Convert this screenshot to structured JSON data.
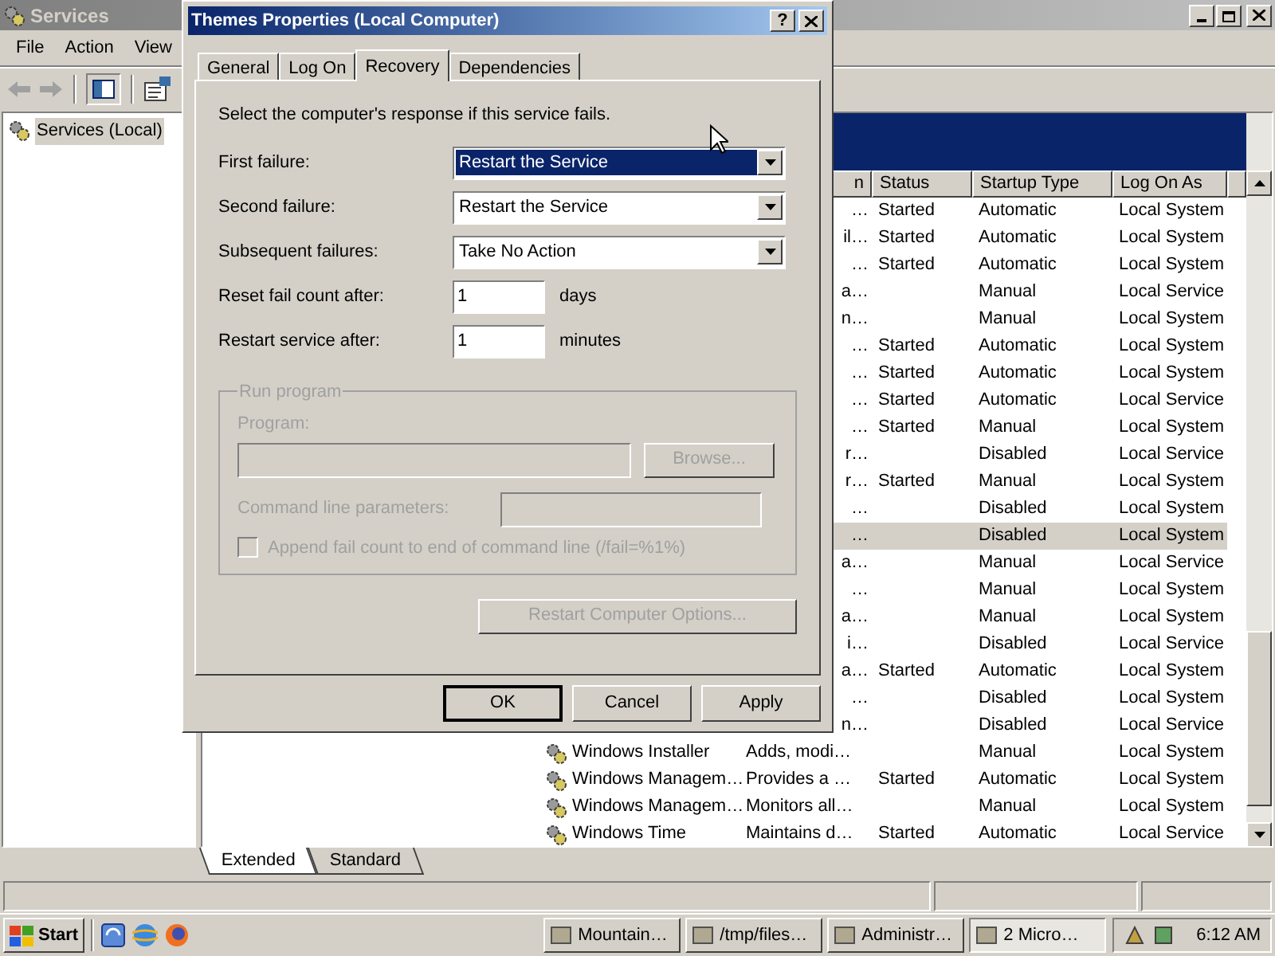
{
  "main_window": {
    "title": "Services",
    "menu": [
      "File",
      "Action",
      "View"
    ],
    "tree": [
      {
        "label": "Services (Local)",
        "selected": true
      }
    ],
    "list": {
      "columns": [
        "n",
        "Status",
        "Startup Type",
        "Log On As"
      ],
      "rows": [
        {
          "description": "…",
          "status": "Started",
          "startup": "Automatic",
          "logon": "Local System",
          "selected": false
        },
        {
          "description": "il…",
          "status": "Started",
          "startup": "Automatic",
          "logon": "Local System",
          "selected": false
        },
        {
          "description": "…",
          "status": "Started",
          "startup": "Automatic",
          "logon": "Local System",
          "selected": false
        },
        {
          "description": "a…",
          "status": "",
          "startup": "Manual",
          "logon": "Local Service",
          "selected": false
        },
        {
          "description": "n…",
          "status": "",
          "startup": "Manual",
          "logon": "Local System",
          "selected": false
        },
        {
          "description": "…",
          "status": "Started",
          "startup": "Automatic",
          "logon": "Local System",
          "selected": false
        },
        {
          "description": "…",
          "status": "Started",
          "startup": "Automatic",
          "logon": "Local System",
          "selected": false
        },
        {
          "description": "…",
          "status": "Started",
          "startup": "Automatic",
          "logon": "Local Service",
          "selected": false
        },
        {
          "description": "…",
          "status": "Started",
          "startup": "Manual",
          "logon": "Local System",
          "selected": false
        },
        {
          "description": "r…",
          "status": "",
          "startup": "Disabled",
          "logon": "Local Service",
          "selected": false
        },
        {
          "description": "r…",
          "status": "Started",
          "startup": "Manual",
          "logon": "Local System",
          "selected": false
        },
        {
          "description": "…",
          "status": "",
          "startup": "Disabled",
          "logon": "Local System",
          "selected": false
        },
        {
          "description": "…",
          "status": "",
          "startup": "Disabled",
          "logon": "Local System",
          "selected": true
        },
        {
          "description": "a…",
          "status": "",
          "startup": "Manual",
          "logon": "Local Service",
          "selected": false
        },
        {
          "description": "…",
          "status": "",
          "startup": "Manual",
          "logon": "Local System",
          "selected": false
        },
        {
          "description": "a…",
          "status": "",
          "startup": "Manual",
          "logon": "Local System",
          "selected": false
        },
        {
          "description": "i…",
          "status": "",
          "startup": "Disabled",
          "logon": "Local Service",
          "selected": false
        },
        {
          "description": "a…",
          "status": "Started",
          "startup": "Automatic",
          "logon": "Local System",
          "selected": false
        },
        {
          "description": "…",
          "status": "",
          "startup": "Disabled",
          "logon": "Local System",
          "selected": false
        },
        {
          "description": "n…",
          "status": "",
          "startup": "Disabled",
          "logon": "Local Service",
          "selected": false
        },
        {
          "name": "Windows Installer",
          "description": "Adds, modi…",
          "status": "",
          "startup": "Manual",
          "logon": "Local System",
          "selected": false
        },
        {
          "name": "Windows Managem…",
          "description": "Provides a …",
          "status": "Started",
          "startup": "Automatic",
          "logon": "Local System",
          "selected": false
        },
        {
          "name": "Windows Managem…",
          "description": "Monitors all…",
          "status": "",
          "startup": "Manual",
          "logon": "Local System",
          "selected": false
        },
        {
          "name": "Windows Time",
          "description": "Maintains d…",
          "status": "Started",
          "startup": "Automatic",
          "logon": "Local Service",
          "selected": false
        }
      ]
    },
    "view_tabs": [
      {
        "label": "Extended",
        "selected": true
      },
      {
        "label": "Standard",
        "selected": false
      }
    ]
  },
  "dialog": {
    "title": "Themes Properties (Local Computer)",
    "help_button": "?",
    "tabs": [
      {
        "label": "General",
        "selected": false
      },
      {
        "label": "Log On",
        "selected": false
      },
      {
        "label": "Recovery",
        "selected": true
      },
      {
        "label": "Dependencies",
        "selected": false
      }
    ],
    "intro": "Select the computer's response if this service fails.",
    "failures": [
      {
        "label": "First failure:",
        "value": "Restart the Service",
        "focused": true
      },
      {
        "label": "Second failure:",
        "value": "Restart the Service",
        "focused": false
      },
      {
        "label": "Subsequent failures:",
        "value": "Take No Action",
        "focused": false
      }
    ],
    "counters": [
      {
        "label": "Reset fail count after:",
        "value": "1",
        "unit": "days"
      },
      {
        "label": "Restart service after:",
        "value": "1",
        "unit": "minutes"
      }
    ],
    "run_program": {
      "legend": "Run program",
      "program_label": "Program:",
      "browse": "Browse...",
      "params_label": "Command line parameters:",
      "append_label": "Append fail count to end of command line (/fail=%1%)",
      "checked": false,
      "disabled": true
    },
    "restart_options": "Restart Computer Options...",
    "buttons": [
      {
        "label": "OK",
        "default": true
      },
      {
        "label": "Cancel",
        "default": false
      },
      {
        "label": "Apply",
        "default": false
      }
    ]
  },
  "taskbar": {
    "start": "Start",
    "tasks": [
      {
        "label": "Mountain…",
        "selected": false
      },
      {
        "label": "/tmp/files…",
        "selected": false
      },
      {
        "label": "Administr…",
        "selected": false
      },
      {
        "label": "2 Micro…",
        "selected": true
      }
    ],
    "clock": "6:12 AM"
  }
}
